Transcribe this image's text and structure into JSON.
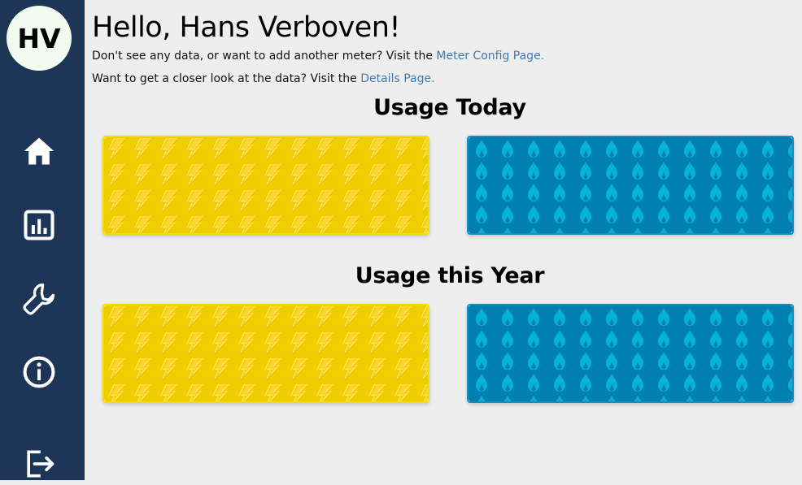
{
  "sidebar": {
    "avatar_initials": "HV",
    "items": [
      {
        "name": "home",
        "icon": "home-icon"
      },
      {
        "name": "details",
        "icon": "chart-icon"
      },
      {
        "name": "meter-config",
        "icon": "wrench-icon"
      },
      {
        "name": "info",
        "icon": "info-icon"
      },
      {
        "name": "logout",
        "icon": "logout-icon"
      }
    ],
    "background_color": "#1d3557"
  },
  "main": {
    "greeting": "Hello, Hans Verboven!",
    "config_prompt": "Don't see any data, or want to add another meter? Visit the ",
    "config_link": "Meter Config Page.",
    "details_prompt": "Want to get a closer look at the data? Visit the ",
    "details_link": "Details Page.",
    "sections": [
      {
        "title": "Usage Today",
        "cards": [
          {
            "type": "electricity",
            "pattern_icon": "lightning-icon",
            "color": "#f0cd00"
          },
          {
            "type": "gas",
            "pattern_icon": "flame-icon",
            "color": "#0080b0"
          }
        ]
      },
      {
        "title": "Usage this Year",
        "cards": [
          {
            "type": "electricity",
            "pattern_icon": "lightning-icon",
            "color": "#f0cd00"
          },
          {
            "type": "gas",
            "pattern_icon": "flame-icon",
            "color": "#0080b0"
          }
        ]
      }
    ],
    "link_color": "#3d7ab0"
  }
}
